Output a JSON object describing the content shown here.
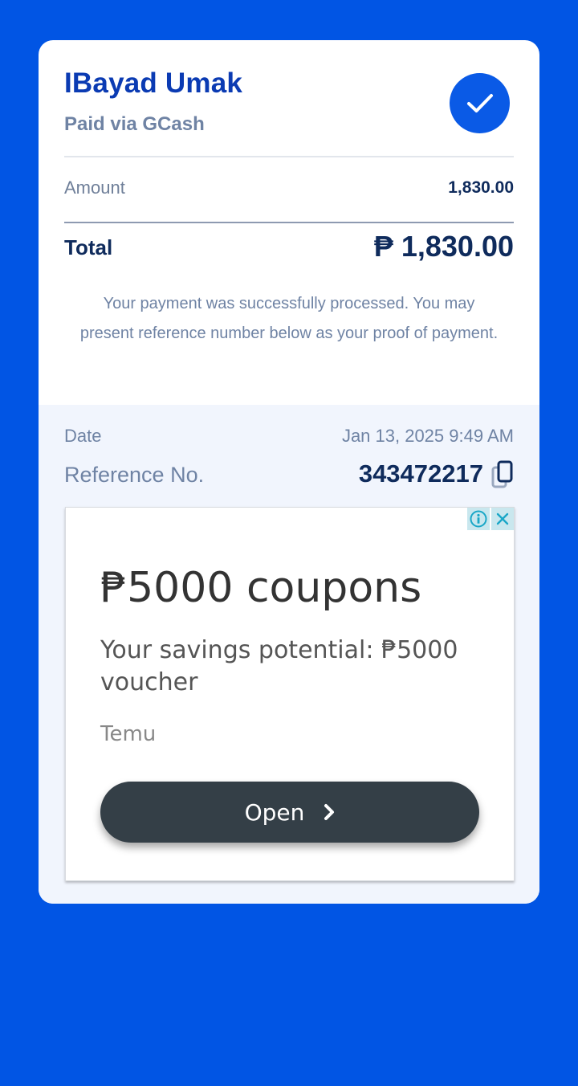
{
  "receipt": {
    "merchant": "IBayad Umak",
    "paid_via": "Paid via GCash",
    "amount_label": "Amount",
    "amount_value": "1,830.00",
    "total_label": "Total",
    "total_value": "₱ 1,830.00",
    "note": "Your payment was successfully processed. You may present reference number below as your proof of payment."
  },
  "details": {
    "date_label": "Date",
    "date_value": "Jan 13, 2025 9:49 AM",
    "ref_label": "Reference No.",
    "ref_value": "343472217"
  },
  "ad": {
    "title": "₱5000 coupons",
    "description": "Your savings potential: ₱5000 voucher",
    "brand": "Temu",
    "button_label": "Open",
    "info_icon": "info-icon",
    "close_icon": "close-icon"
  },
  "colors": {
    "background": "#0155e4",
    "accent": "#0a5ae6",
    "primary_text": "#0f2b5c",
    "muted_text": "#6f83a4"
  }
}
